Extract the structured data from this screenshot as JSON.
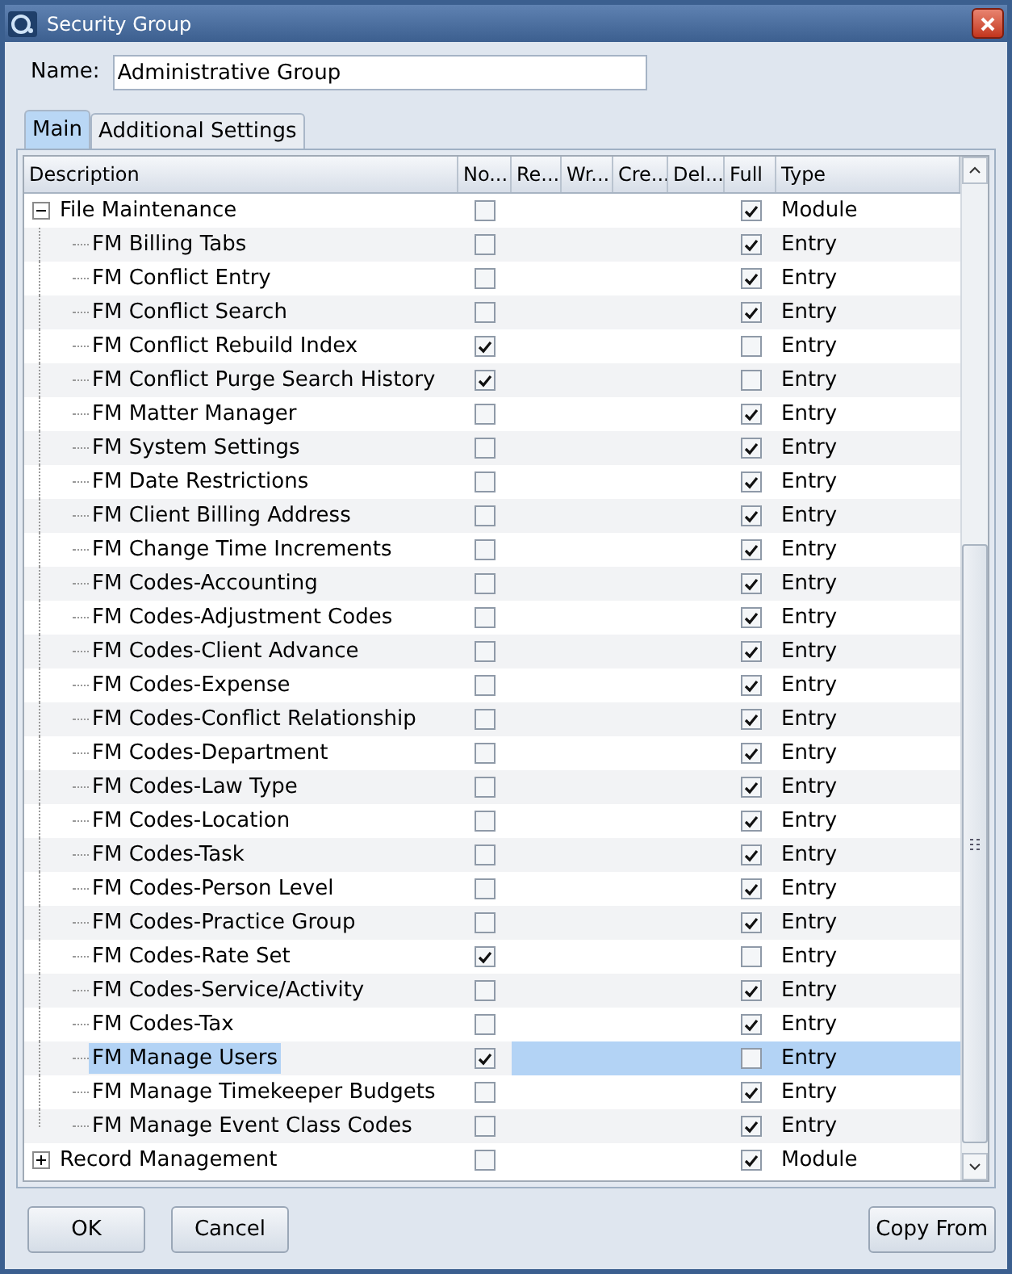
{
  "window": {
    "title": "Security Group"
  },
  "name_field": {
    "label": "Name:",
    "value": "Administrative Group"
  },
  "tabs": [
    {
      "label": "Main",
      "selected": true
    },
    {
      "label": "Additional Settings",
      "selected": false
    }
  ],
  "columns": [
    "Description",
    "No...",
    "Re...",
    "Wr...",
    "Cre...",
    "Del...",
    "Full",
    "Type"
  ],
  "tree": [
    {
      "description": "File Maintenance",
      "no": false,
      "full": true,
      "type": "Module",
      "expanded": true,
      "selected": false,
      "children": [
        {
          "description": "FM Billing Tabs",
          "no": false,
          "full": true,
          "type": "Entry",
          "selected": false
        },
        {
          "description": "FM Conflict Entry",
          "no": false,
          "full": true,
          "type": "Entry",
          "selected": false
        },
        {
          "description": "FM Conflict Search",
          "no": false,
          "full": true,
          "type": "Entry",
          "selected": false
        },
        {
          "description": "FM Conflict Rebuild Index",
          "no": true,
          "full": false,
          "type": "Entry",
          "selected": false
        },
        {
          "description": "FM Conflict Purge Search History",
          "no": true,
          "full": false,
          "type": "Entry",
          "selected": false
        },
        {
          "description": "FM Matter Manager",
          "no": false,
          "full": true,
          "type": "Entry",
          "selected": false
        },
        {
          "description": "FM System Settings",
          "no": false,
          "full": true,
          "type": "Entry",
          "selected": false
        },
        {
          "description": "FM Date Restrictions",
          "no": false,
          "full": true,
          "type": "Entry",
          "selected": false
        },
        {
          "description": "FM Client Billing Address",
          "no": false,
          "full": true,
          "type": "Entry",
          "selected": false
        },
        {
          "description": "FM Change Time Increments",
          "no": false,
          "full": true,
          "type": "Entry",
          "selected": false
        },
        {
          "description": "FM Codes-Accounting",
          "no": false,
          "full": true,
          "type": "Entry",
          "selected": false
        },
        {
          "description": "FM Codes-Adjustment Codes",
          "no": false,
          "full": true,
          "type": "Entry",
          "selected": false
        },
        {
          "description": "FM Codes-Client Advance",
          "no": false,
          "full": true,
          "type": "Entry",
          "selected": false
        },
        {
          "description": "FM Codes-Expense",
          "no": false,
          "full": true,
          "type": "Entry",
          "selected": false
        },
        {
          "description": "FM Codes-Conflict Relationship",
          "no": false,
          "full": true,
          "type": "Entry",
          "selected": false
        },
        {
          "description": "FM Codes-Department",
          "no": false,
          "full": true,
          "type": "Entry",
          "selected": false
        },
        {
          "description": "FM Codes-Law Type",
          "no": false,
          "full": true,
          "type": "Entry",
          "selected": false
        },
        {
          "description": "FM Codes-Location",
          "no": false,
          "full": true,
          "type": "Entry",
          "selected": false
        },
        {
          "description": "FM Codes-Task",
          "no": false,
          "full": true,
          "type": "Entry",
          "selected": false
        },
        {
          "description": "FM Codes-Person Level",
          "no": false,
          "full": true,
          "type": "Entry",
          "selected": false
        },
        {
          "description": "FM Codes-Practice Group",
          "no": false,
          "full": true,
          "type": "Entry",
          "selected": false
        },
        {
          "description": "FM Codes-Rate Set",
          "no": true,
          "full": false,
          "type": "Entry",
          "selected": false
        },
        {
          "description": "FM Codes-Service/Activity",
          "no": false,
          "full": true,
          "type": "Entry",
          "selected": false
        },
        {
          "description": "FM Codes-Tax",
          "no": false,
          "full": true,
          "type": "Entry",
          "selected": false
        },
        {
          "description": "FM Manage Users",
          "no": true,
          "full": false,
          "type": "Entry",
          "selected": true
        },
        {
          "description": "FM Manage Timekeeper Budgets",
          "no": false,
          "full": true,
          "type": "Entry",
          "selected": false
        },
        {
          "description": "FM Manage Event Class Codes",
          "no": false,
          "full": true,
          "type": "Entry",
          "selected": false
        }
      ]
    },
    {
      "description": "Record Management",
      "no": false,
      "full": true,
      "type": "Module",
      "expanded": false,
      "selected": false
    }
  ],
  "buttons": [
    {
      "label": "OK"
    },
    {
      "label": "Cancel"
    },
    {
      "label": "Copy From"
    }
  ]
}
